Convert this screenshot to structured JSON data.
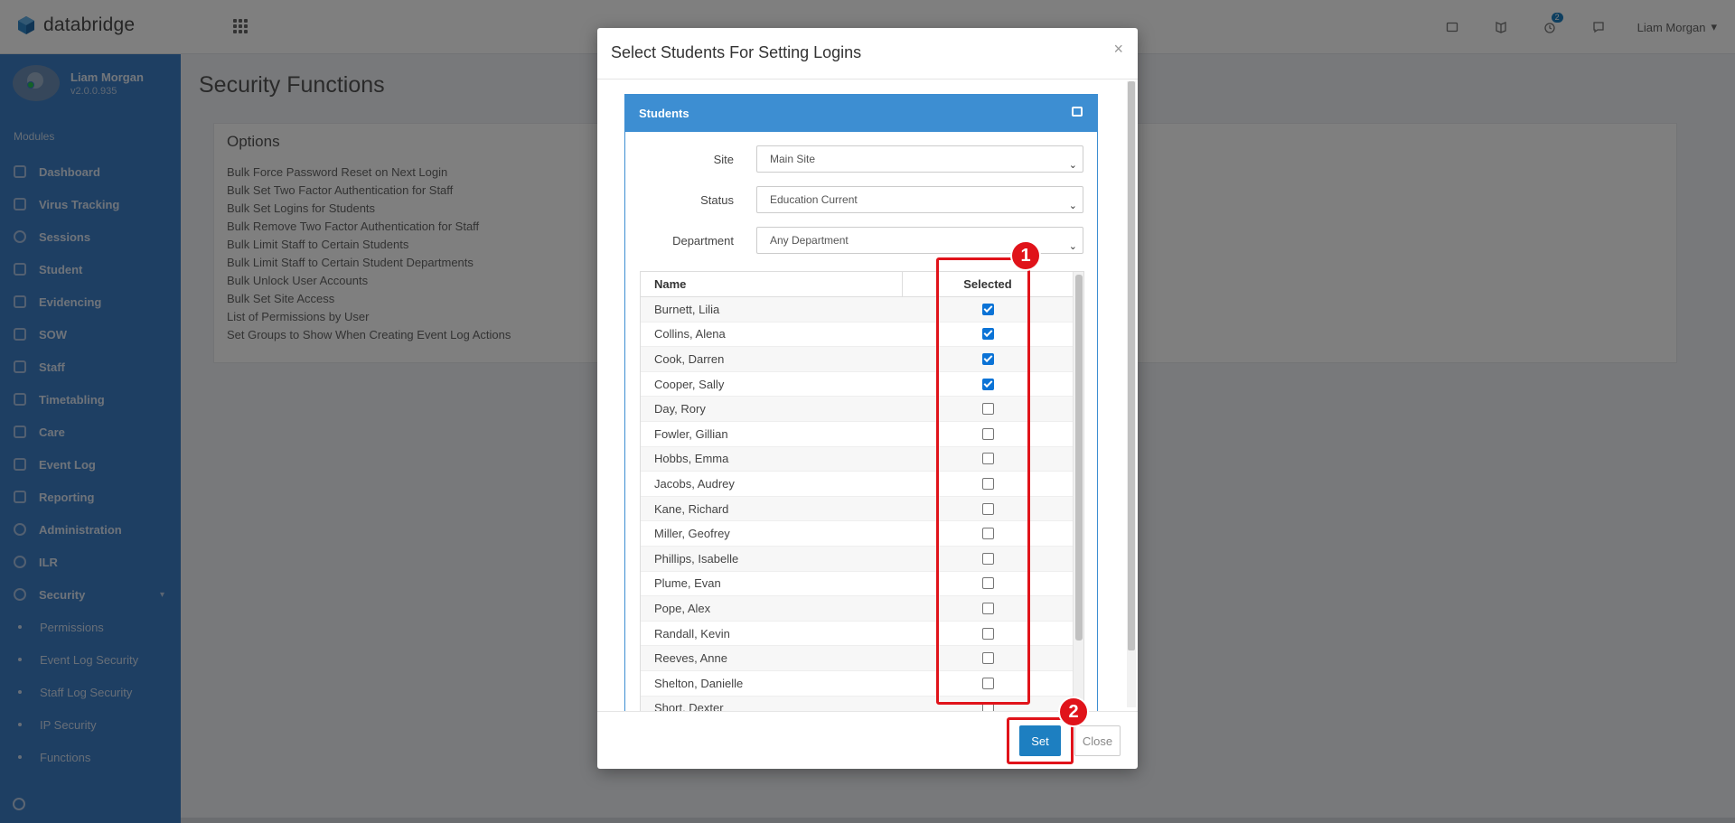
{
  "app": {
    "brand": "databridge"
  },
  "header": {
    "notification_count": "2",
    "user_name": "Liam Morgan",
    "icons": [
      "tablet-icon",
      "book-icon",
      "alarm-icon",
      "chat-icon"
    ]
  },
  "sidebar": {
    "profile_name": "Liam Morgan",
    "version": "v2.0.0.935",
    "modules_label": "Modules",
    "items": [
      {
        "label": "Dashboard"
      },
      {
        "label": "Virus Tracking"
      },
      {
        "label": "Sessions"
      },
      {
        "label": "Student"
      },
      {
        "label": "Evidencing"
      },
      {
        "label": "SOW"
      },
      {
        "label": "Staff"
      },
      {
        "label": "Timetabling"
      },
      {
        "label": "Care"
      },
      {
        "label": "Event Log"
      },
      {
        "label": "Reporting"
      },
      {
        "label": "Administration"
      },
      {
        "label": "ILR"
      },
      {
        "label": "Security"
      }
    ],
    "sub_items": [
      {
        "label": "Permissions"
      },
      {
        "label": "Event Log Security"
      },
      {
        "label": "Staff Log Security"
      },
      {
        "label": "IP Security"
      },
      {
        "label": "Functions"
      }
    ]
  },
  "main": {
    "page_title": "Security Functions",
    "options_title": "Options",
    "options": [
      "Bulk Force Password Reset on Next Login",
      "Bulk Set Two Factor Authentication for Staff",
      "Bulk Set Logins for Students",
      "Bulk Remove Two Factor Authentication for Staff",
      "Bulk Limit Staff to Certain Students",
      "Bulk Limit Staff to Certain Student Departments",
      "Bulk Unlock User Accounts",
      "Bulk Set Site Access",
      "List of Permissions by User",
      "Set Groups to Show When Creating Event Log Actions"
    ]
  },
  "modal": {
    "title": "Select Students For Setting Logins",
    "close_symbol": "×",
    "panel_title": "Students",
    "filters": {
      "site_label": "Site",
      "site_value": "Main Site",
      "status_label": "Status",
      "status_value": "Education Current",
      "department_label": "Department",
      "department_value": "Any Department"
    },
    "grid": {
      "col_name": "Name",
      "col_selected": "Selected",
      "rows": [
        {
          "name": "Burnett, Lilia",
          "selected": true
        },
        {
          "name": "Collins, Alena",
          "selected": true
        },
        {
          "name": "Cook, Darren",
          "selected": true
        },
        {
          "name": "Cooper, Sally",
          "selected": true
        },
        {
          "name": "Day, Rory",
          "selected": false
        },
        {
          "name": "Fowler, Gillian",
          "selected": false
        },
        {
          "name": "Hobbs, Emma",
          "selected": false
        },
        {
          "name": "Jacobs, Audrey",
          "selected": false
        },
        {
          "name": "Kane, Richard",
          "selected": false
        },
        {
          "name": "Miller, Geofrey",
          "selected": false
        },
        {
          "name": "Phillips, Isabelle",
          "selected": false
        },
        {
          "name": "Plume, Evan",
          "selected": false
        },
        {
          "name": "Pope, Alex",
          "selected": false
        },
        {
          "name": "Randall, Kevin",
          "selected": false
        },
        {
          "name": "Reeves, Anne",
          "selected": false
        },
        {
          "name": "Shelton, Danielle",
          "selected": false
        },
        {
          "name": "Short, Dexter",
          "selected": false
        }
      ]
    },
    "set_label": "Set",
    "close_label": "Close"
  },
  "annotations": [
    {
      "number": "1"
    },
    {
      "number": "2"
    }
  ],
  "colors": {
    "sidebar": "#3d7ec7",
    "panel_header": "#3d8ed2",
    "primary_button": "#1d7fc1",
    "annotation": "#e0131a"
  }
}
